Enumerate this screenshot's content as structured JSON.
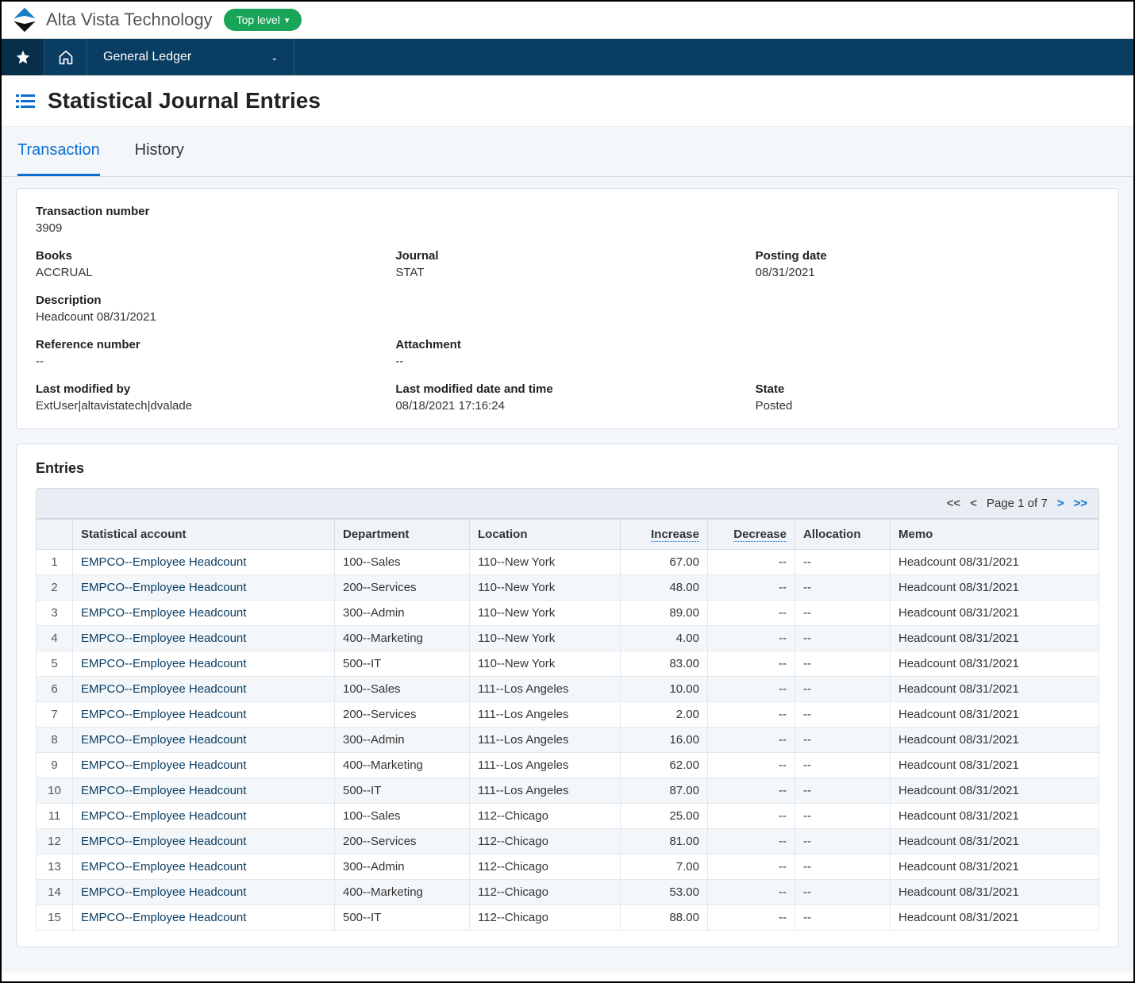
{
  "header": {
    "company": "Alta Vista Technology",
    "top_level_label": "Top level"
  },
  "nav": {
    "module_label": "General Ledger"
  },
  "page": {
    "title": "Statistical Journal Entries"
  },
  "tabs": {
    "transaction": "Transaction",
    "history": "History"
  },
  "tx": {
    "labels": {
      "transaction_number": "Transaction number",
      "books": "Books",
      "journal": "Journal",
      "posting_date": "Posting date",
      "description": "Description",
      "reference_number": "Reference number",
      "attachment": "Attachment",
      "last_modified_by": "Last modified by",
      "last_modified_dt": "Last modified date and time",
      "state": "State"
    },
    "values": {
      "transaction_number": "3909",
      "books": "ACCRUAL",
      "journal": "STAT",
      "posting_date": "08/31/2021",
      "description": "Headcount 08/31/2021",
      "reference_number": "--",
      "attachment": "--",
      "last_modified_by": "ExtUser|altavistatech|dvalade",
      "last_modified_dt": "08/18/2021 17:16:24",
      "state": "Posted"
    }
  },
  "entries": {
    "section_title": "Entries",
    "pager": {
      "first": "<<",
      "prev": "<",
      "text": "Page 1 of 7",
      "next": ">",
      "last": ">>"
    },
    "columns": {
      "stat_account": "Statistical account",
      "department": "Department",
      "location": "Location",
      "increase": "Increase",
      "decrease": "Decrease",
      "allocation": "Allocation",
      "memo": "Memo"
    },
    "rows": [
      {
        "n": "1",
        "acct": "EMPCO--Employee Headcount",
        "dept": "100--Sales",
        "loc": "110--New York",
        "inc": "67.00",
        "dec": "--",
        "alloc": "--",
        "memo": "Headcount 08/31/2021"
      },
      {
        "n": "2",
        "acct": "EMPCO--Employee Headcount",
        "dept": "200--Services",
        "loc": "110--New York",
        "inc": "48.00",
        "dec": "--",
        "alloc": "--",
        "memo": "Headcount 08/31/2021"
      },
      {
        "n": "3",
        "acct": "EMPCO--Employee Headcount",
        "dept": "300--Admin",
        "loc": "110--New York",
        "inc": "89.00",
        "dec": "--",
        "alloc": "--",
        "memo": "Headcount 08/31/2021"
      },
      {
        "n": "4",
        "acct": "EMPCO--Employee Headcount",
        "dept": "400--Marketing",
        "loc": "110--New York",
        "inc": "4.00",
        "dec": "--",
        "alloc": "--",
        "memo": "Headcount 08/31/2021"
      },
      {
        "n": "5",
        "acct": "EMPCO--Employee Headcount",
        "dept": "500--IT",
        "loc": "110--New York",
        "inc": "83.00",
        "dec": "--",
        "alloc": "--",
        "memo": "Headcount 08/31/2021"
      },
      {
        "n": "6",
        "acct": "EMPCO--Employee Headcount",
        "dept": "100--Sales",
        "loc": "111--Los Angeles",
        "inc": "10.00",
        "dec": "--",
        "alloc": "--",
        "memo": "Headcount 08/31/2021"
      },
      {
        "n": "7",
        "acct": "EMPCO--Employee Headcount",
        "dept": "200--Services",
        "loc": "111--Los Angeles",
        "inc": "2.00",
        "dec": "--",
        "alloc": "--",
        "memo": "Headcount 08/31/2021"
      },
      {
        "n": "8",
        "acct": "EMPCO--Employee Headcount",
        "dept": "300--Admin",
        "loc": "111--Los Angeles",
        "inc": "16.00",
        "dec": "--",
        "alloc": "--",
        "memo": "Headcount 08/31/2021"
      },
      {
        "n": "9",
        "acct": "EMPCO--Employee Headcount",
        "dept": "400--Marketing",
        "loc": "111--Los Angeles",
        "inc": "62.00",
        "dec": "--",
        "alloc": "--",
        "memo": "Headcount 08/31/2021"
      },
      {
        "n": "10",
        "acct": "EMPCO--Employee Headcount",
        "dept": "500--IT",
        "loc": "111--Los Angeles",
        "inc": "87.00",
        "dec": "--",
        "alloc": "--",
        "memo": "Headcount 08/31/2021"
      },
      {
        "n": "11",
        "acct": "EMPCO--Employee Headcount",
        "dept": "100--Sales",
        "loc": "112--Chicago",
        "inc": "25.00",
        "dec": "--",
        "alloc": "--",
        "memo": "Headcount 08/31/2021"
      },
      {
        "n": "12",
        "acct": "EMPCO--Employee Headcount",
        "dept": "200--Services",
        "loc": "112--Chicago",
        "inc": "81.00",
        "dec": "--",
        "alloc": "--",
        "memo": "Headcount 08/31/2021"
      },
      {
        "n": "13",
        "acct": "EMPCO--Employee Headcount",
        "dept": "300--Admin",
        "loc": "112--Chicago",
        "inc": "7.00",
        "dec": "--",
        "alloc": "--",
        "memo": "Headcount 08/31/2021"
      },
      {
        "n": "14",
        "acct": "EMPCO--Employee Headcount",
        "dept": "400--Marketing",
        "loc": "112--Chicago",
        "inc": "53.00",
        "dec": "--",
        "alloc": "--",
        "memo": "Headcount 08/31/2021"
      },
      {
        "n": "15",
        "acct": "EMPCO--Employee Headcount",
        "dept": "500--IT",
        "loc": "112--Chicago",
        "inc": "88.00",
        "dec": "--",
        "alloc": "--",
        "memo": "Headcount 08/31/2021"
      }
    ]
  }
}
